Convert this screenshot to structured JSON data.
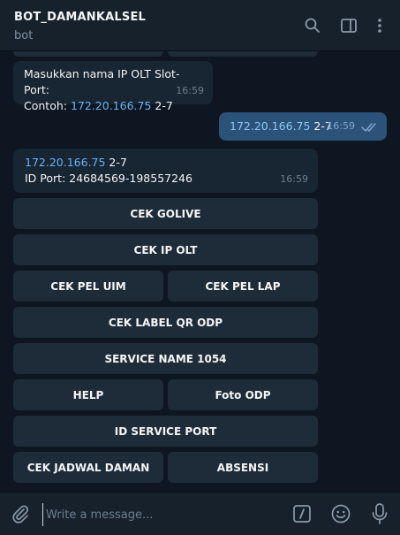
{
  "header": {
    "title": "BOT_DAMANKALSEL",
    "subtitle": "bot",
    "icons": [
      "search-icon",
      "sidebar-toggle-icon",
      "more-vertical-icon"
    ]
  },
  "messages": {
    "prompt": {
      "line1": "Masukkan nama IP OLT Slot-Port:",
      "line2_prefix": "Contoh: ",
      "line2_link": "172.20.166.75",
      "line2_suffix": " 2-7",
      "time": "16:59"
    },
    "outgoing": {
      "link": "172.20.166.75",
      "suffix": " 2-7",
      "time": "16:59",
      "status": "read"
    },
    "result": {
      "line1_link": "172.20.166.75",
      "line1_suffix": " 2-7",
      "line2": "ID Port: 24684569-198557246",
      "time": "16:59"
    }
  },
  "keyboard": {
    "cek_golive": "CEK GOLIVE",
    "cek_ip_olt": "CEK IP OLT",
    "cek_pel_uim": "CEK PEL UIM",
    "cek_pel_lap": "CEK PEL LAP",
    "cek_label_qr_odp": "CEK LABEL QR ODP",
    "service_name": "SERVICE NAME 1054",
    "help": "HELP",
    "foto_odp": "Foto ODP",
    "id_service_port": "ID SERVICE PORT",
    "cek_jadwal_daman": "CEK JADWAL DAMAN",
    "absensi": "ABSENSI"
  },
  "composer": {
    "placeholder": "Write a message...",
    "value": "",
    "icons": [
      "attach-icon",
      "command-icon",
      "emoji-icon",
      "microphone-icon"
    ]
  },
  "colors": {
    "background": "#0e1621",
    "header": "#17212b",
    "incoming_bubble": "#182533",
    "outgoing_bubble": "#2b5278",
    "link": "#6ab3f3",
    "keyboard_button": "#1e2c3a"
  }
}
